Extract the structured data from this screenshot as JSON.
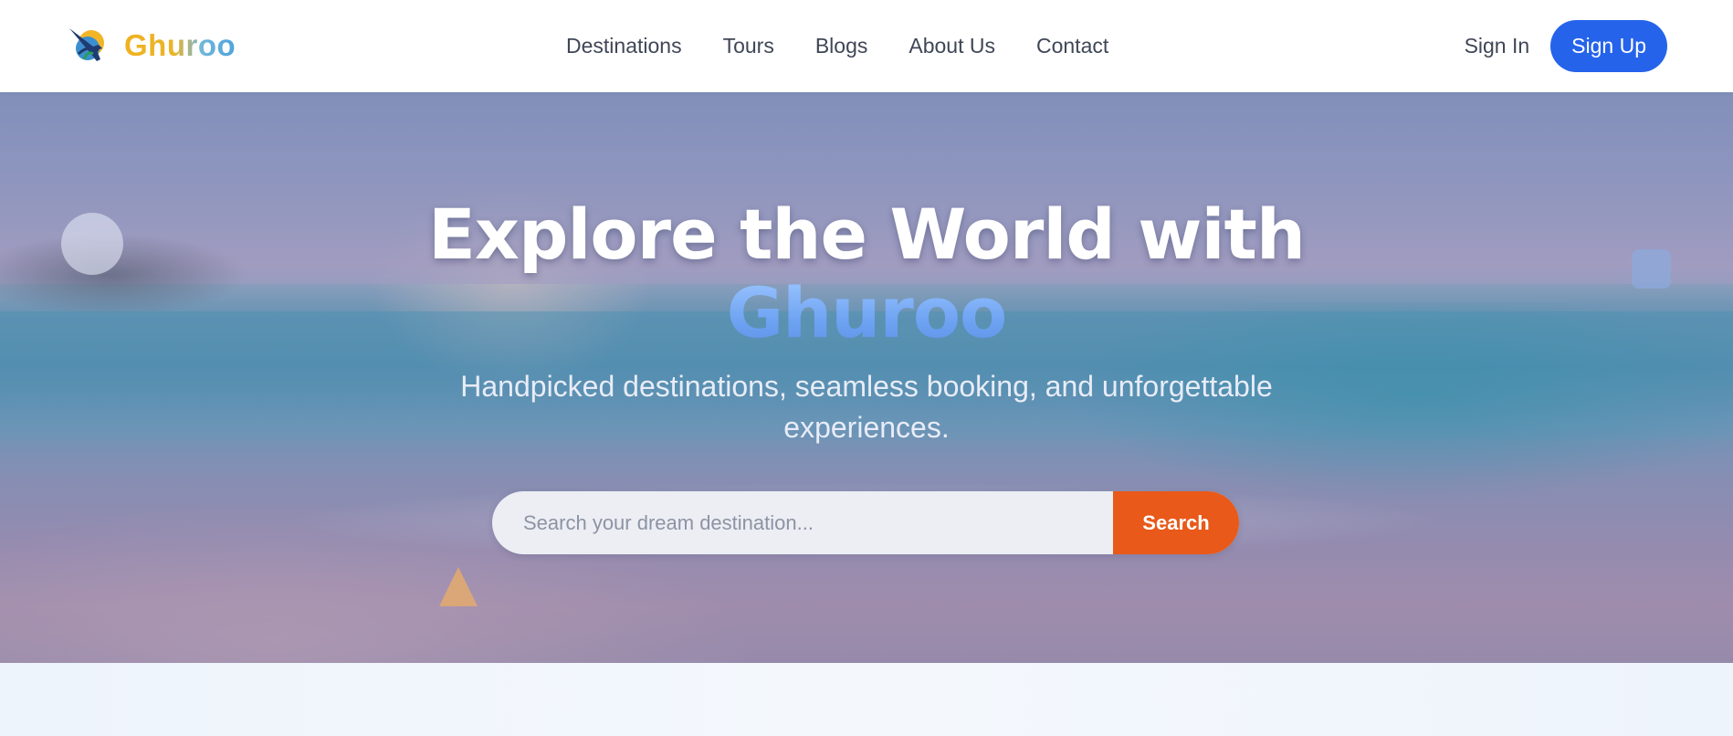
{
  "brand": {
    "name": "Ghuroo",
    "logo_icon": "plane-globe-logo-icon"
  },
  "nav": {
    "links": [
      "Destinations",
      "Tours",
      "Blogs",
      "About Us",
      "Contact"
    ],
    "sign_in": "Sign In",
    "sign_up": "Sign Up"
  },
  "hero": {
    "title_line1": "Explore the World with",
    "title_accent": "Ghuroo",
    "subtitle": "Handpicked destinations, seamless booking, and unforgettable experiences.",
    "search": {
      "placeholder": "Search your dream destination...",
      "value": "",
      "button": "Search"
    }
  },
  "colors": {
    "primary": "#2563eb",
    "search_button": "#e8591a",
    "accent_gradient": "#6ea3f2"
  }
}
